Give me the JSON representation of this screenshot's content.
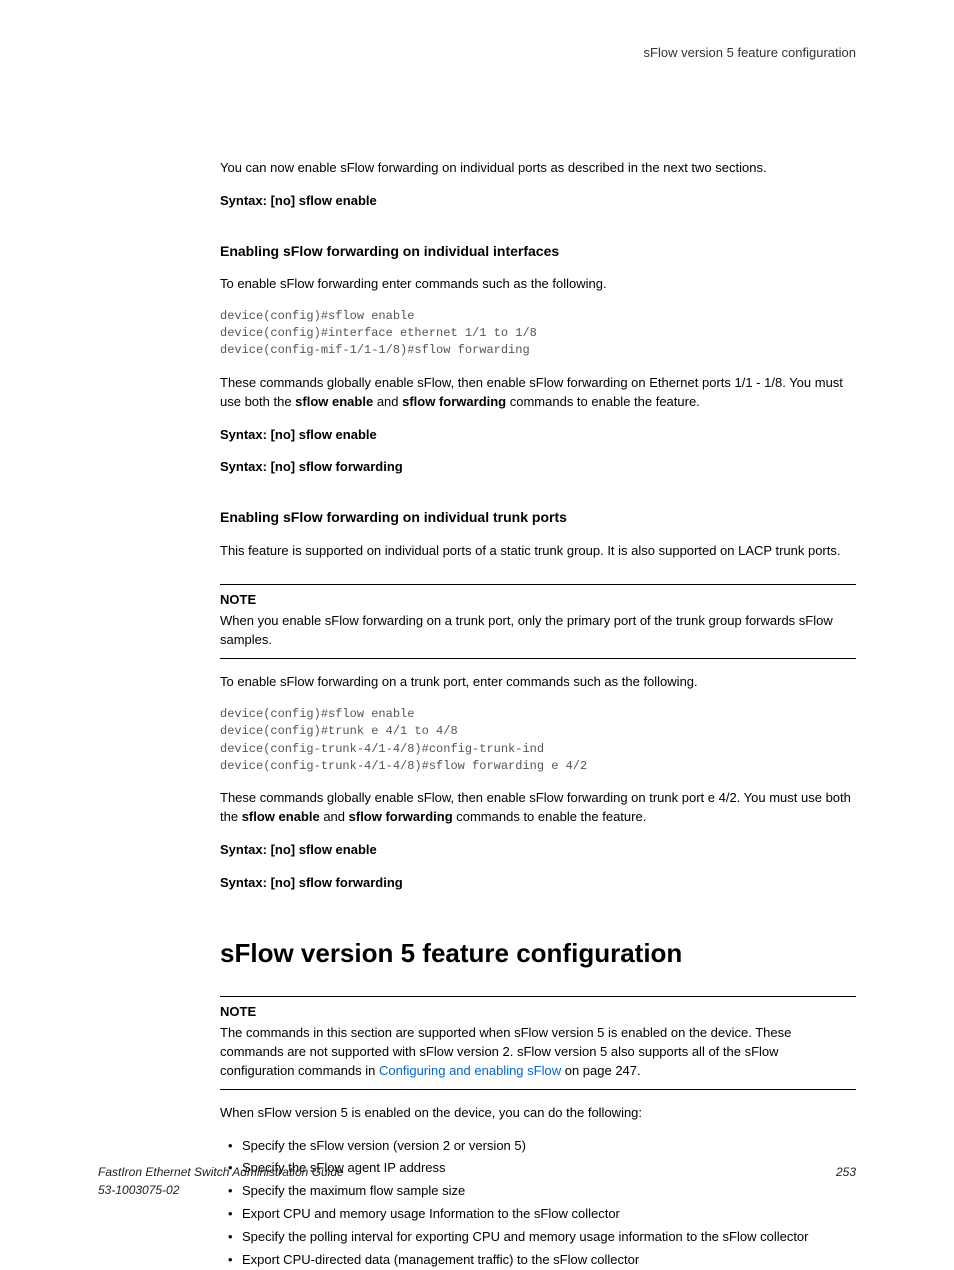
{
  "runningHead": "sFlow version 5 feature configuration",
  "intro": "You can now enable sFlow forwarding on individual ports as described in the next two sections.",
  "syntax1": "Syntax: [no] sflow enable",
  "sectionA": {
    "title": "Enabling sFlow forwarding on individual interfaces",
    "lead": "To enable sFlow forwarding enter commands such as the following.",
    "code": "device(config)#sflow enable\ndevice(config)#interface ethernet 1/1 to 1/8\ndevice(config-mif-1/1-1/8)#sflow forwarding",
    "after_pre": "These commands globally enable sFlow, then enable sFlow forwarding on Ethernet ports 1/1 - 1/8. You must use both the ",
    "bold1": "sflow enable",
    "after_mid": " and ",
    "bold2": "sflow forwarding",
    "after_post": " commands to enable the feature.",
    "syntaxA": "Syntax: [no] sflow enable",
    "syntaxB": "Syntax: [no] sflow forwarding"
  },
  "sectionB": {
    "title": "Enabling sFlow forwarding on individual trunk ports",
    "lead": "This feature is supported on individual ports of a static trunk group. It is also supported on LACP trunk ports.",
    "noteLabel": "NOTE",
    "noteBody": "When you enable sFlow forwarding on a trunk port, only the primary port of the trunk group forwards sFlow samples.",
    "lead2": "To enable sFlow forwarding on a trunk port, enter commands such as the following.",
    "code": "device(config)#sflow enable\ndevice(config)#trunk e 4/1 to 4/8\ndevice(config-trunk-4/1-4/8)#config-trunk-ind\ndevice(config-trunk-4/1-4/8)#sflow forwarding e 4/2",
    "after_pre": "These commands globally enable sFlow, then enable sFlow forwarding on trunk port e 4/2. You must use both the ",
    "bold1": "sflow enable",
    "after_mid": " and ",
    "bold2": "sflow forwarding",
    "after_post": " commands to enable the feature.",
    "syntaxA": "Syntax: [no] sflow enable",
    "syntaxB": "Syntax: [no] sflow forwarding"
  },
  "sectionC": {
    "title": "sFlow version 5 feature configuration",
    "noteLabel": "NOTE",
    "note_pre": "The commands in this section are supported when sFlow version 5 is enabled on the device. These commands are not supported with sFlow version 2. sFlow version 5 also supports all of the sFlow configuration commands in ",
    "note_link": "Configuring and enabling sFlow",
    "note_post": " on page 247.",
    "lead": "When sFlow version 5 is enabled on the device, you can do the following:",
    "bullets": [
      "Specify the sFlow version (version 2 or version 5)",
      "Specify the sFlow agent IP address",
      "Specify the maximum flow sample size",
      "Export CPU and memory usage Information to the sFlow collector",
      "Specify the polling interval for exporting CPU and memory usage information to the sFlow collector",
      "Export CPU-directed data (management traffic) to the sFlow collector"
    ]
  },
  "footer": {
    "line1": "FastIron Ethernet Switch Administration Guide",
    "line2": "53-1003075-02",
    "pagenum": "253"
  }
}
